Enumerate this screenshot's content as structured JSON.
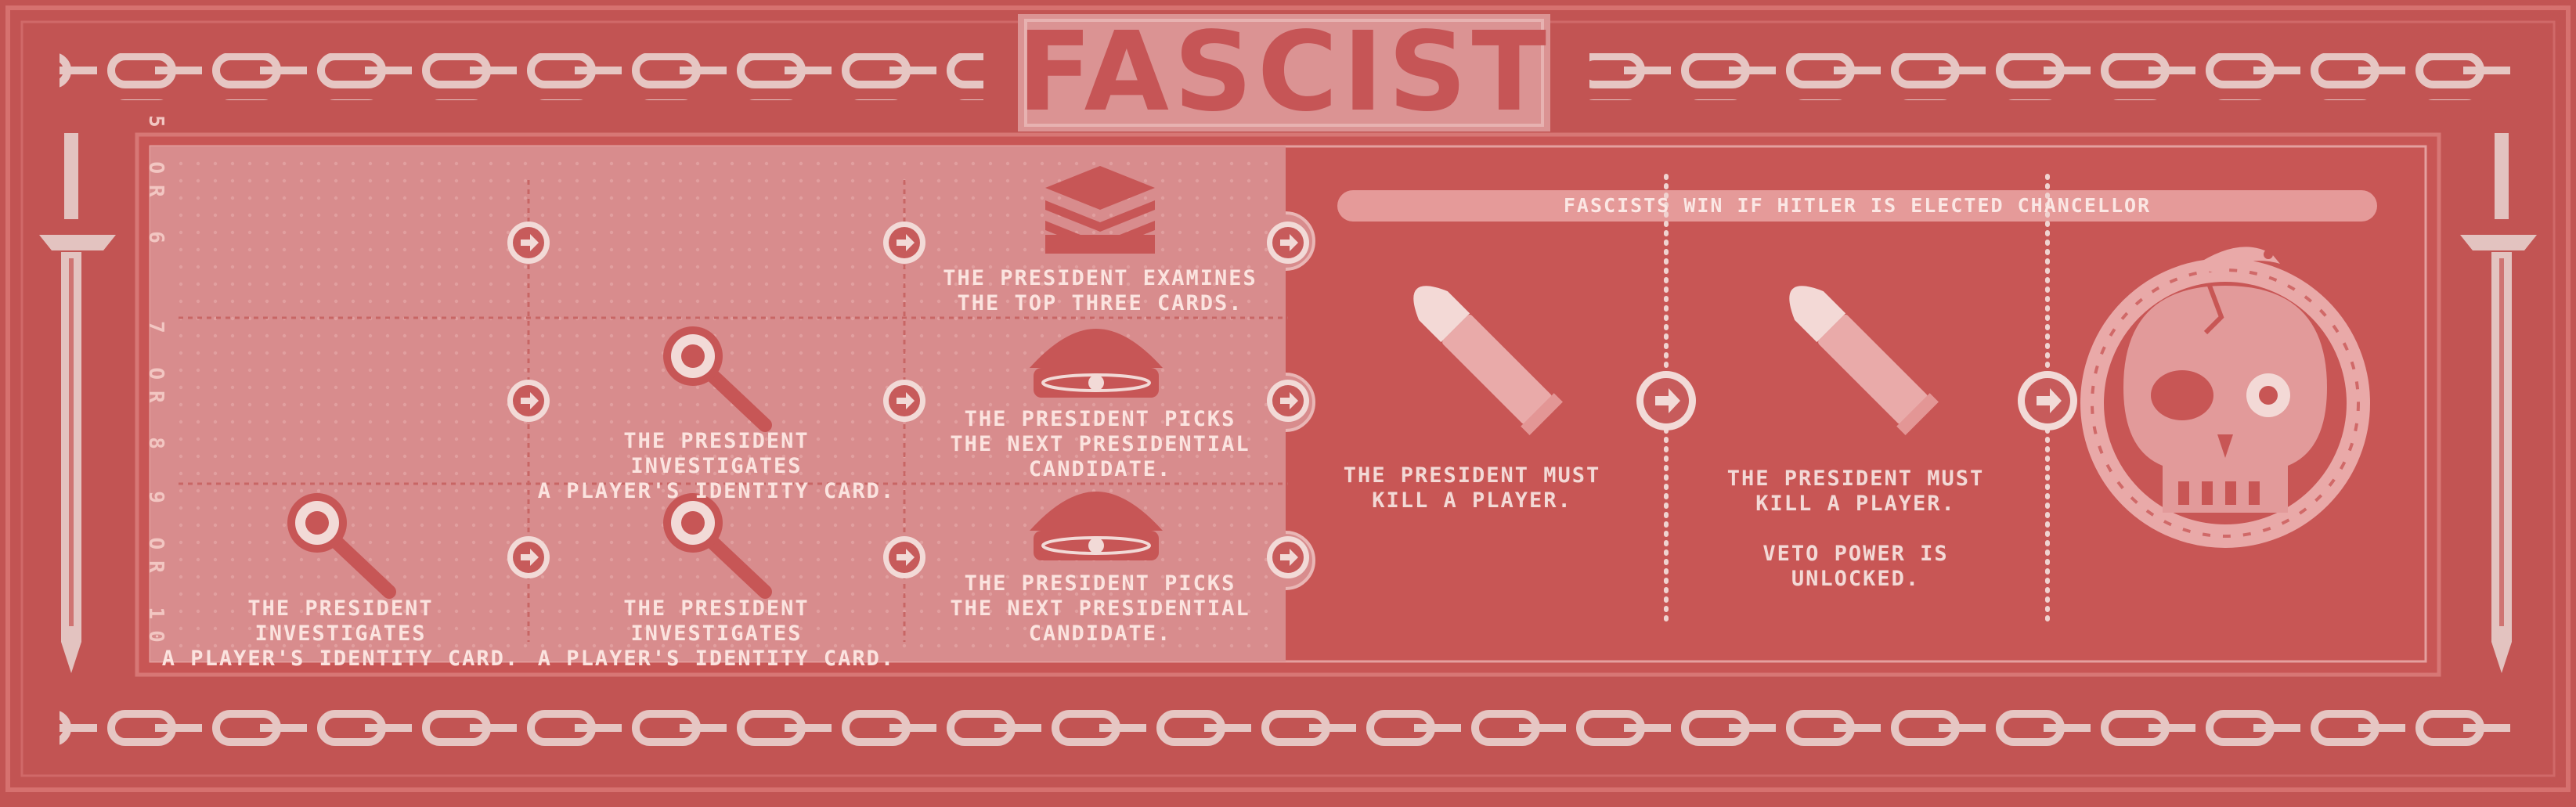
{
  "board": {
    "title": "FASCIST",
    "rule_banner": "FASCISTS WIN IF HITLER IS ELECTED CHANCELLOR",
    "player_counts": [
      "5 OR 6",
      "7 OR 8",
      "9 OR 10"
    ],
    "tracks": [
      {
        "player_count": "5 OR 6",
        "powers": [
          {
            "text": "",
            "icon": ""
          },
          {
            "text": "",
            "icon": ""
          },
          {
            "text": "THE PRESIDENT EXAMINES\nTHE TOP THREE CARDS.",
            "icon": "card-stack-icon"
          }
        ]
      },
      {
        "player_count": "7 OR 8",
        "powers": [
          {
            "text": "",
            "icon": ""
          },
          {
            "text": "THE PRESIDENT INVESTIGATES\nA PLAYER'S IDENTITY CARD.",
            "icon": "magnifier-icon"
          },
          {
            "text": "THE PRESIDENT PICKS\nTHE NEXT PRESIDENTIAL\nCANDIDATE.",
            "icon": "officer-cap-icon"
          }
        ]
      },
      {
        "player_count": "9 OR 10",
        "powers": [
          {
            "text": "THE PRESIDENT INVESTIGATES\nA PLAYER'S IDENTITY CARD.",
            "icon": "magnifier-icon"
          },
          {
            "text": "THE PRESIDENT INVESTIGATES\nA PLAYER'S IDENTITY CARD.",
            "icon": "magnifier-icon"
          },
          {
            "text": "THE PRESIDENT PICKS\nTHE NEXT PRESIDENTIAL\nCANDIDATE.",
            "icon": "officer-cap-icon"
          }
        ]
      }
    ],
    "shared_slots": [
      {
        "text": "THE PRESIDENT MUST\nKILL A PLAYER.",
        "icon": "bullet-icon"
      },
      {
        "text": "THE PRESIDENT MUST\nKILL A PLAYER.\n\nVETO POWER IS\nUNLOCKED.",
        "icon": "bullet-icon"
      },
      {
        "text": "",
        "icon": "skull-snake-icon"
      }
    ],
    "colors": {
      "background": "#c25453",
      "panel": "#cc5a59",
      "light_panel": "#d88c8d",
      "ink": "#f2c6c2"
    }
  }
}
